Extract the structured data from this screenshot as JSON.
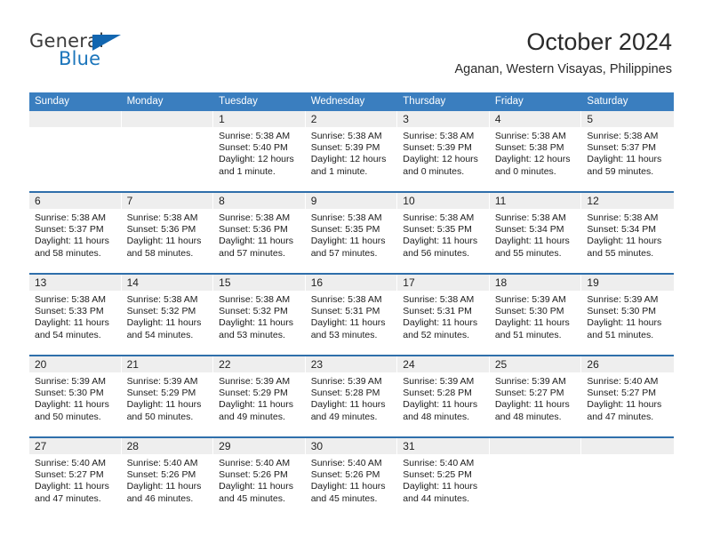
{
  "brand": {
    "name_top": "General",
    "name_bottom": "Blue",
    "accent_color": "#1b75bb",
    "triangle_color": "#1266b0"
  },
  "header": {
    "title": "October 2024",
    "subtitle": "Aganan, Western Visayas, Philippines"
  },
  "theme": {
    "header_row_color": "#3a7ebf",
    "week_divider_color": "#2f6fab",
    "day_band_color": "#eeeeee"
  },
  "weekdays": [
    "Sunday",
    "Monday",
    "Tuesday",
    "Wednesday",
    "Thursday",
    "Friday",
    "Saturday"
  ],
  "weeks": [
    [
      {
        "day": "",
        "empty": true,
        "sunrise": "",
        "sunset": "",
        "daylight_line1": "",
        "daylight_line2": ""
      },
      {
        "day": "",
        "empty": true,
        "sunrise": "",
        "sunset": "",
        "daylight_line1": "",
        "daylight_line2": ""
      },
      {
        "day": "1",
        "empty": false,
        "sunrise": "Sunrise: 5:38 AM",
        "sunset": "Sunset: 5:40 PM",
        "daylight_line1": "Daylight: 12 hours",
        "daylight_line2": "and 1 minute."
      },
      {
        "day": "2",
        "empty": false,
        "sunrise": "Sunrise: 5:38 AM",
        "sunset": "Sunset: 5:39 PM",
        "daylight_line1": "Daylight: 12 hours",
        "daylight_line2": "and 1 minute."
      },
      {
        "day": "3",
        "empty": false,
        "sunrise": "Sunrise: 5:38 AM",
        "sunset": "Sunset: 5:39 PM",
        "daylight_line1": "Daylight: 12 hours",
        "daylight_line2": "and 0 minutes."
      },
      {
        "day": "4",
        "empty": false,
        "sunrise": "Sunrise: 5:38 AM",
        "sunset": "Sunset: 5:38 PM",
        "daylight_line1": "Daylight: 12 hours",
        "daylight_line2": "and 0 minutes."
      },
      {
        "day": "5",
        "empty": false,
        "sunrise": "Sunrise: 5:38 AM",
        "sunset": "Sunset: 5:37 PM",
        "daylight_line1": "Daylight: 11 hours",
        "daylight_line2": "and 59 minutes."
      }
    ],
    [
      {
        "day": "6",
        "empty": false,
        "sunrise": "Sunrise: 5:38 AM",
        "sunset": "Sunset: 5:37 PM",
        "daylight_line1": "Daylight: 11 hours",
        "daylight_line2": "and 58 minutes."
      },
      {
        "day": "7",
        "empty": false,
        "sunrise": "Sunrise: 5:38 AM",
        "sunset": "Sunset: 5:36 PM",
        "daylight_line1": "Daylight: 11 hours",
        "daylight_line2": "and 58 minutes."
      },
      {
        "day": "8",
        "empty": false,
        "sunrise": "Sunrise: 5:38 AM",
        "sunset": "Sunset: 5:36 PM",
        "daylight_line1": "Daylight: 11 hours",
        "daylight_line2": "and 57 minutes."
      },
      {
        "day": "9",
        "empty": false,
        "sunrise": "Sunrise: 5:38 AM",
        "sunset": "Sunset: 5:35 PM",
        "daylight_line1": "Daylight: 11 hours",
        "daylight_line2": "and 57 minutes."
      },
      {
        "day": "10",
        "empty": false,
        "sunrise": "Sunrise: 5:38 AM",
        "sunset": "Sunset: 5:35 PM",
        "daylight_line1": "Daylight: 11 hours",
        "daylight_line2": "and 56 minutes."
      },
      {
        "day": "11",
        "empty": false,
        "sunrise": "Sunrise: 5:38 AM",
        "sunset": "Sunset: 5:34 PM",
        "daylight_line1": "Daylight: 11 hours",
        "daylight_line2": "and 55 minutes."
      },
      {
        "day": "12",
        "empty": false,
        "sunrise": "Sunrise: 5:38 AM",
        "sunset": "Sunset: 5:34 PM",
        "daylight_line1": "Daylight: 11 hours",
        "daylight_line2": "and 55 minutes."
      }
    ],
    [
      {
        "day": "13",
        "empty": false,
        "sunrise": "Sunrise: 5:38 AM",
        "sunset": "Sunset: 5:33 PM",
        "daylight_line1": "Daylight: 11 hours",
        "daylight_line2": "and 54 minutes."
      },
      {
        "day": "14",
        "empty": false,
        "sunrise": "Sunrise: 5:38 AM",
        "sunset": "Sunset: 5:32 PM",
        "daylight_line1": "Daylight: 11 hours",
        "daylight_line2": "and 54 minutes."
      },
      {
        "day": "15",
        "empty": false,
        "sunrise": "Sunrise: 5:38 AM",
        "sunset": "Sunset: 5:32 PM",
        "daylight_line1": "Daylight: 11 hours",
        "daylight_line2": "and 53 minutes."
      },
      {
        "day": "16",
        "empty": false,
        "sunrise": "Sunrise: 5:38 AM",
        "sunset": "Sunset: 5:31 PM",
        "daylight_line1": "Daylight: 11 hours",
        "daylight_line2": "and 53 minutes."
      },
      {
        "day": "17",
        "empty": false,
        "sunrise": "Sunrise: 5:38 AM",
        "sunset": "Sunset: 5:31 PM",
        "daylight_line1": "Daylight: 11 hours",
        "daylight_line2": "and 52 minutes."
      },
      {
        "day": "18",
        "empty": false,
        "sunrise": "Sunrise: 5:39 AM",
        "sunset": "Sunset: 5:30 PM",
        "daylight_line1": "Daylight: 11 hours",
        "daylight_line2": "and 51 minutes."
      },
      {
        "day": "19",
        "empty": false,
        "sunrise": "Sunrise: 5:39 AM",
        "sunset": "Sunset: 5:30 PM",
        "daylight_line1": "Daylight: 11 hours",
        "daylight_line2": "and 51 minutes."
      }
    ],
    [
      {
        "day": "20",
        "empty": false,
        "sunrise": "Sunrise: 5:39 AM",
        "sunset": "Sunset: 5:30 PM",
        "daylight_line1": "Daylight: 11 hours",
        "daylight_line2": "and 50 minutes."
      },
      {
        "day": "21",
        "empty": false,
        "sunrise": "Sunrise: 5:39 AM",
        "sunset": "Sunset: 5:29 PM",
        "daylight_line1": "Daylight: 11 hours",
        "daylight_line2": "and 50 minutes."
      },
      {
        "day": "22",
        "empty": false,
        "sunrise": "Sunrise: 5:39 AM",
        "sunset": "Sunset: 5:29 PM",
        "daylight_line1": "Daylight: 11 hours",
        "daylight_line2": "and 49 minutes."
      },
      {
        "day": "23",
        "empty": false,
        "sunrise": "Sunrise: 5:39 AM",
        "sunset": "Sunset: 5:28 PM",
        "daylight_line1": "Daylight: 11 hours",
        "daylight_line2": "and 49 minutes."
      },
      {
        "day": "24",
        "empty": false,
        "sunrise": "Sunrise: 5:39 AM",
        "sunset": "Sunset: 5:28 PM",
        "daylight_line1": "Daylight: 11 hours",
        "daylight_line2": "and 48 minutes."
      },
      {
        "day": "25",
        "empty": false,
        "sunrise": "Sunrise: 5:39 AM",
        "sunset": "Sunset: 5:27 PM",
        "daylight_line1": "Daylight: 11 hours",
        "daylight_line2": "and 48 minutes."
      },
      {
        "day": "26",
        "empty": false,
        "sunrise": "Sunrise: 5:40 AM",
        "sunset": "Sunset: 5:27 PM",
        "daylight_line1": "Daylight: 11 hours",
        "daylight_line2": "and 47 minutes."
      }
    ],
    [
      {
        "day": "27",
        "empty": false,
        "sunrise": "Sunrise: 5:40 AM",
        "sunset": "Sunset: 5:27 PM",
        "daylight_line1": "Daylight: 11 hours",
        "daylight_line2": "and 47 minutes."
      },
      {
        "day": "28",
        "empty": false,
        "sunrise": "Sunrise: 5:40 AM",
        "sunset": "Sunset: 5:26 PM",
        "daylight_line1": "Daylight: 11 hours",
        "daylight_line2": "and 46 minutes."
      },
      {
        "day": "29",
        "empty": false,
        "sunrise": "Sunrise: 5:40 AM",
        "sunset": "Sunset: 5:26 PM",
        "daylight_line1": "Daylight: 11 hours",
        "daylight_line2": "and 45 minutes."
      },
      {
        "day": "30",
        "empty": false,
        "sunrise": "Sunrise: 5:40 AM",
        "sunset": "Sunset: 5:26 PM",
        "daylight_line1": "Daylight: 11 hours",
        "daylight_line2": "and 45 minutes."
      },
      {
        "day": "31",
        "empty": false,
        "sunrise": "Sunrise: 5:40 AM",
        "sunset": "Sunset: 5:25 PM",
        "daylight_line1": "Daylight: 11 hours",
        "daylight_line2": "and 44 minutes."
      },
      {
        "day": "",
        "empty": true,
        "sunrise": "",
        "sunset": "",
        "daylight_line1": "",
        "daylight_line2": ""
      },
      {
        "day": "",
        "empty": true,
        "sunrise": "",
        "sunset": "",
        "daylight_line1": "",
        "daylight_line2": ""
      }
    ]
  ]
}
